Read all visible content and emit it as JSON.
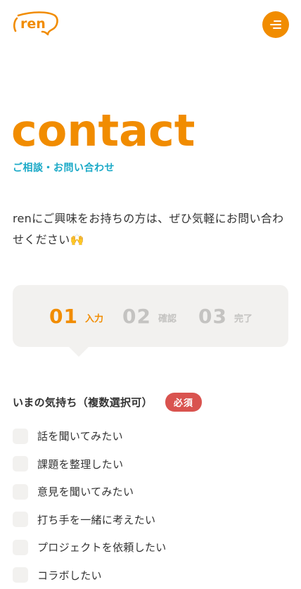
{
  "header": {
    "logo_text": "ren",
    "menu_label": "menu"
  },
  "main": {
    "title": "contact",
    "subtitle": "ご相談・お問い合わせ",
    "intro_text": "renにご興味をお持ちの方は、ぜひ気軽にお問い合わせください",
    "intro_emoji": "🙌"
  },
  "steps": [
    {
      "num": "01",
      "label": "入力",
      "active": true
    },
    {
      "num": "02",
      "label": "確認",
      "active": false
    },
    {
      "num": "03",
      "label": "完了",
      "active": false
    }
  ],
  "form": {
    "question_label": "いまの気持ち（複数選択可）",
    "required_badge": "必須",
    "options": [
      "話を聞いてみたい",
      "課題を整理したい",
      "意見を聞いてみたい",
      "打ち手を一緒に考えたい",
      "プロジェクトを依頼したい",
      "コラボしたい"
    ]
  },
  "colors": {
    "brand_orange": "#f18c00",
    "accent_cyan": "#1aa9c7",
    "required_red": "#d9534f",
    "panel_gray": "#f2f1ef"
  }
}
